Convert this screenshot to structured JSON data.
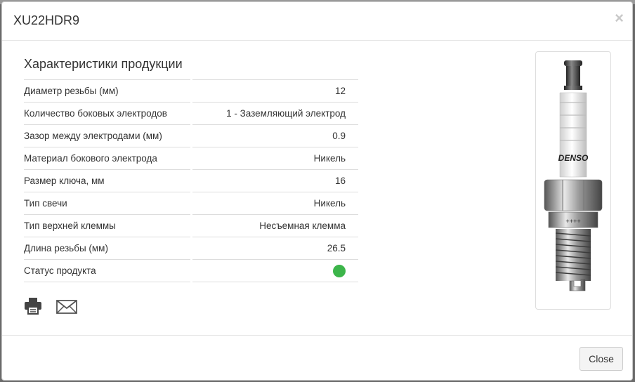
{
  "modal": {
    "title": "XU22HDR9",
    "close_symbol": "×",
    "section_title": "Характеристики продукции",
    "specs": [
      {
        "label": "Диаметр резьбы (мм)",
        "value": "12"
      },
      {
        "label": "Количество боковых электродов",
        "value": "1 - Заземляющий электрод"
      },
      {
        "label": "Зазор между электродами (мм)",
        "value": "0.9"
      },
      {
        "label": "Материал бокового электрода",
        "value": "Никель"
      },
      {
        "label": "Размер ключа, мм",
        "value": "16"
      },
      {
        "label": "Тип свечи",
        "value": "Никель"
      },
      {
        "label": "Тип верхней клеммы",
        "value": "Несъемная клемма"
      },
      {
        "label": "Длина резьбы (мм)",
        "value": "26.5"
      },
      {
        "label": "Статус продукта",
        "value": "",
        "status_color": "#3cb54a"
      }
    ],
    "actions": [
      {
        "icon": "printer-icon"
      },
      {
        "icon": "envelope-icon"
      }
    ],
    "image": {
      "brand_text": "DENSO"
    },
    "footer": {
      "close_label": "Close"
    }
  }
}
